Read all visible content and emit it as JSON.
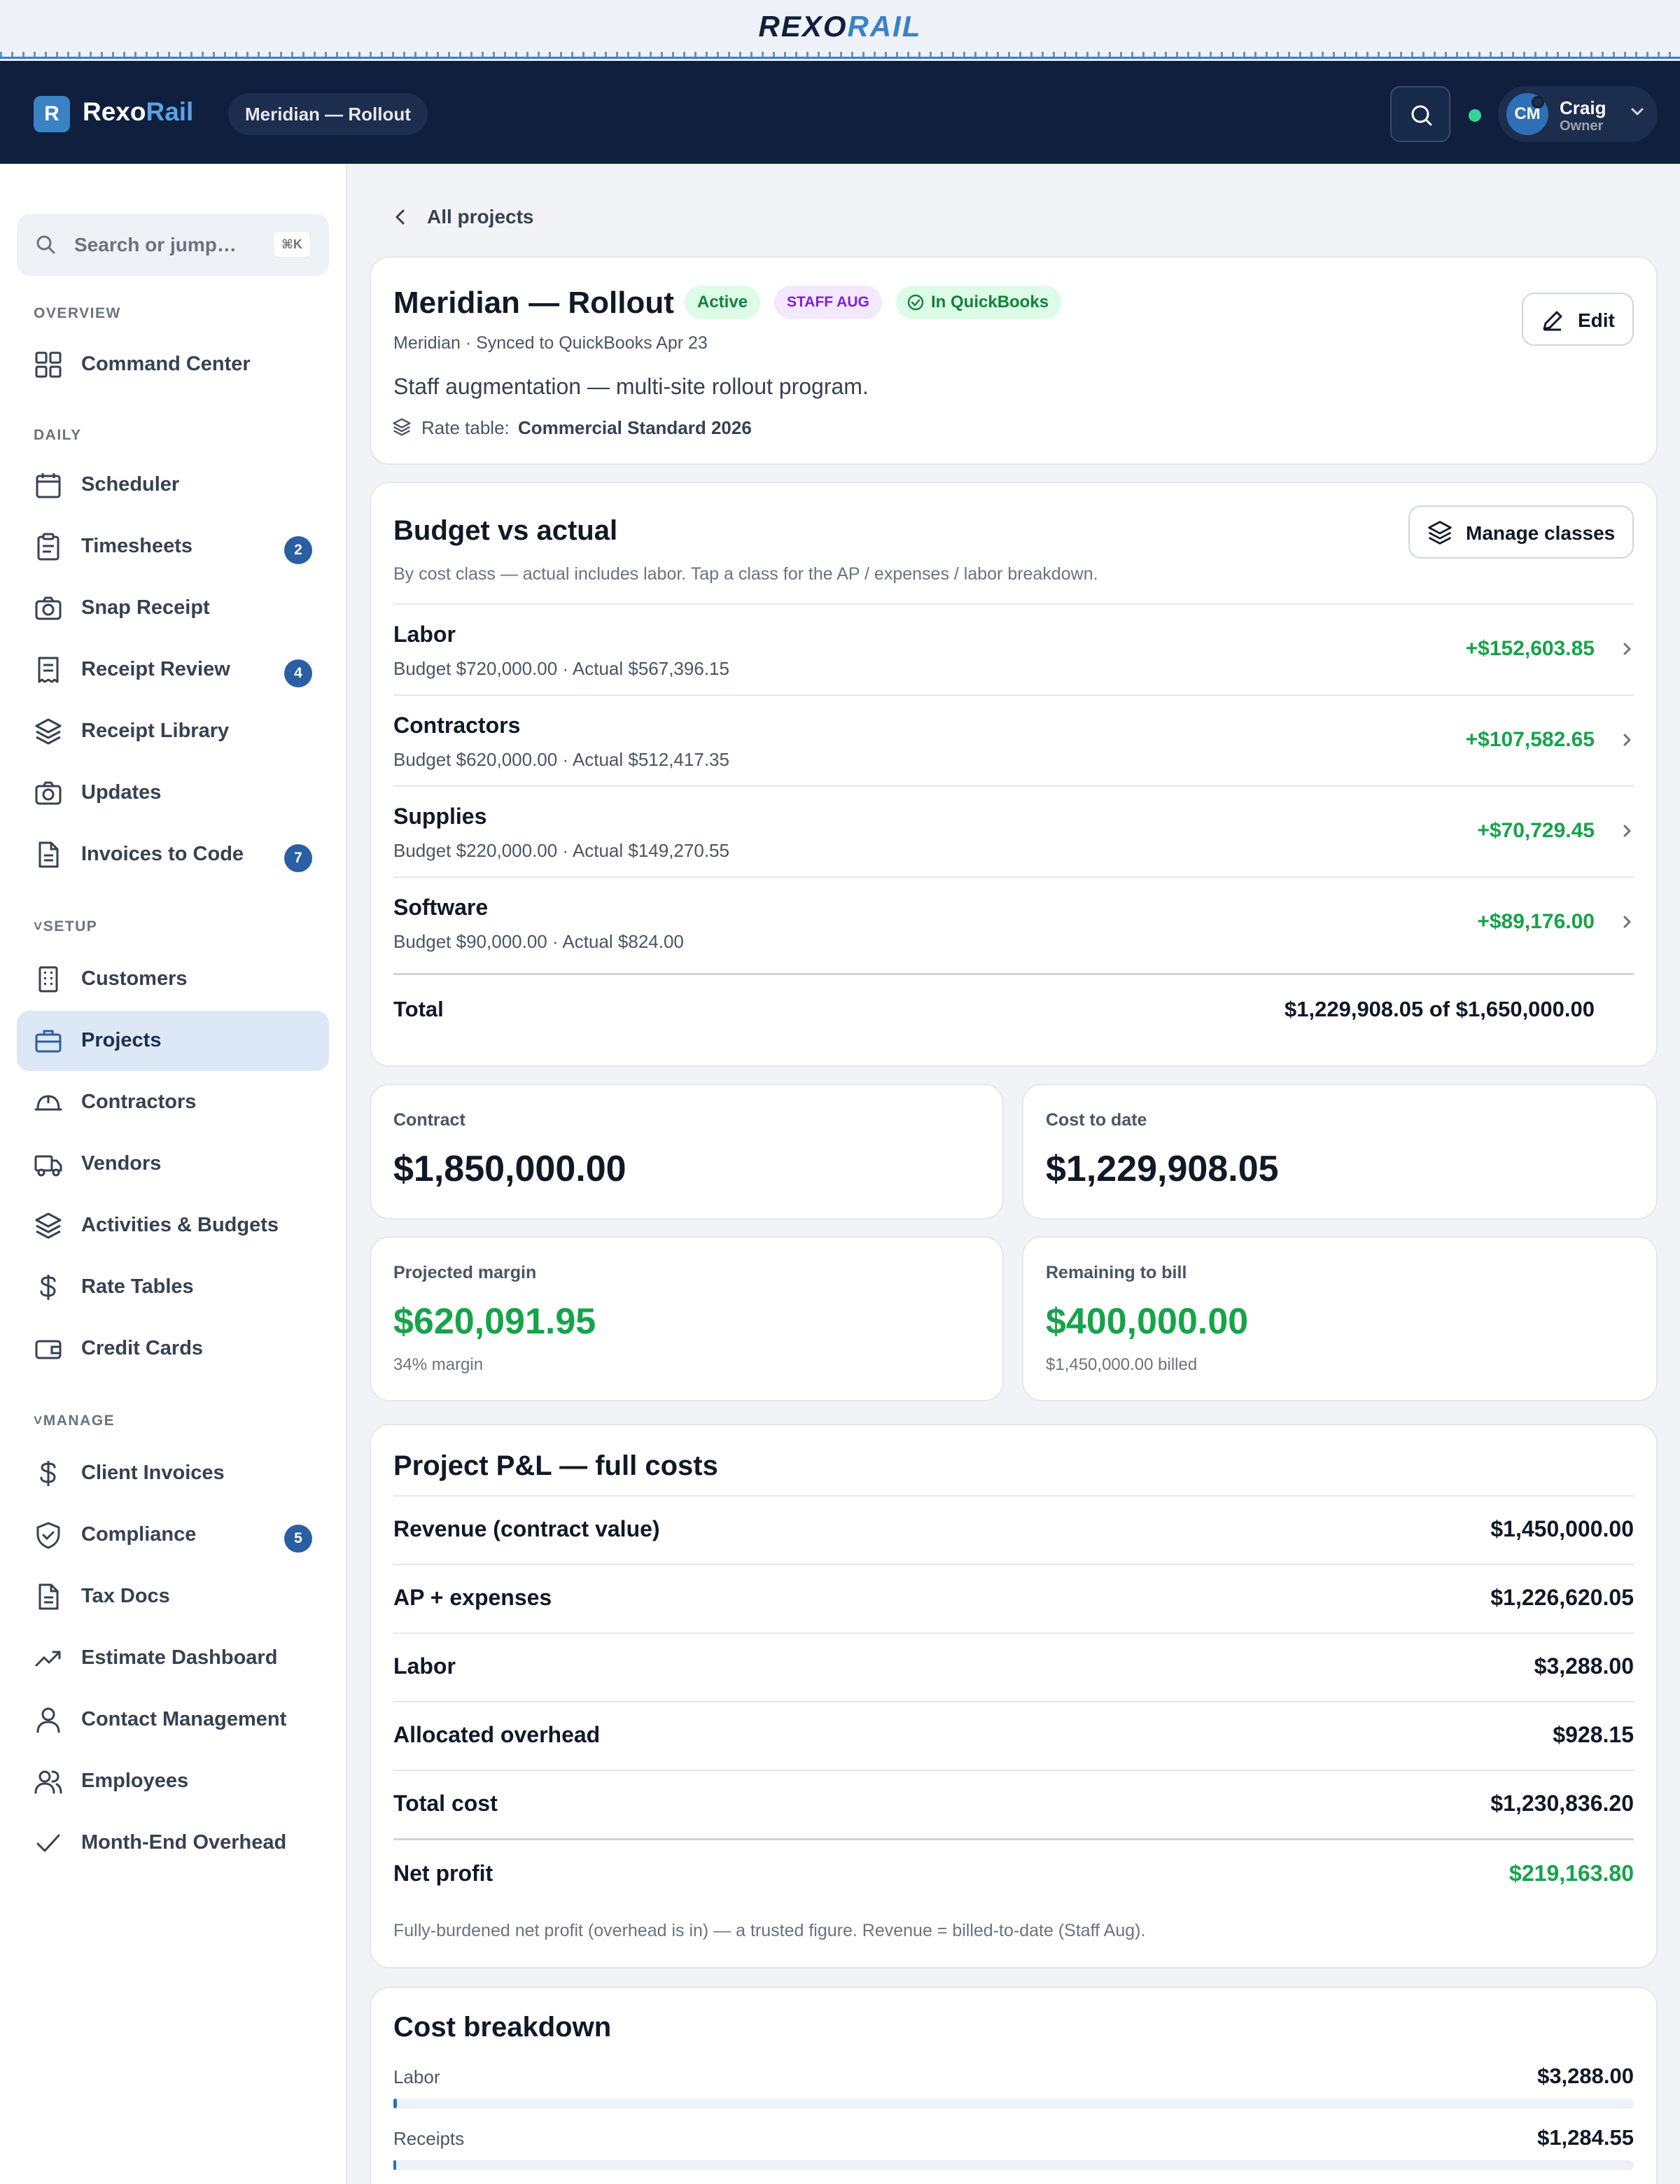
{
  "brand": {
    "wordmark_a": "REXO",
    "wordmark_b": "RAIL"
  },
  "header": {
    "logo_letter": "R",
    "app_name_a": "Rexo",
    "app_name_b": "Rail",
    "project_pill": "Meridian — Rollout",
    "user": {
      "initials": "CM",
      "name": "Craig",
      "role": "Owner"
    },
    "status_color": "#34d399"
  },
  "sidebar": {
    "search_placeholder": "Search or jump…",
    "search_shortcut": "⌘K",
    "sections": {
      "overview": "OVERVIEW",
      "daily": "DAILY",
      "setup": "SETUP",
      "manage": "MANAGE"
    },
    "items": [
      {
        "label": "Command Center",
        "icon": "grid-icon"
      },
      {
        "label": "Scheduler",
        "icon": "calendar-icon"
      },
      {
        "label": "Timesheets",
        "icon": "clipboard-icon",
        "badge": "2"
      },
      {
        "label": "Snap Receipt",
        "icon": "camera-icon"
      },
      {
        "label": "Receipt Review",
        "icon": "receipt-icon",
        "badge": "4"
      },
      {
        "label": "Receipt Library",
        "icon": "layers-icon"
      },
      {
        "label": "Updates",
        "icon": "camera-icon"
      },
      {
        "label": "Invoices to Code",
        "icon": "file-icon",
        "badge": "7"
      },
      {
        "label": "Customers",
        "icon": "building-icon"
      },
      {
        "label": "Projects",
        "icon": "briefcase-icon",
        "active": true
      },
      {
        "label": "Contractors",
        "icon": "hardhat-icon"
      },
      {
        "label": "Vendors",
        "icon": "truck-icon"
      },
      {
        "label": "Activities & Budgets",
        "icon": "layers-icon"
      },
      {
        "label": "Rate Tables",
        "icon": "dollar-icon"
      },
      {
        "label": "Credit Cards",
        "icon": "wallet-icon"
      },
      {
        "label": "Client Invoices",
        "icon": "dollar-icon"
      },
      {
        "label": "Compliance",
        "icon": "shield-icon",
        "badge": "5"
      },
      {
        "label": "Tax Docs",
        "icon": "file-icon"
      },
      {
        "label": "Estimate Dashboard",
        "icon": "trending-up-icon"
      },
      {
        "label": "Contact Management",
        "icon": "user-icon"
      },
      {
        "label": "Employees",
        "icon": "users-icon"
      },
      {
        "label": "Month-End Overhead",
        "icon": "check-icon"
      }
    ]
  },
  "main": {
    "back_label": "All projects",
    "project": {
      "title": "Meridian — Rollout",
      "tags": {
        "active": "Active",
        "type": "STAFF AUG",
        "qb": "In QuickBooks"
      },
      "meta": "Meridian · Synced to QuickBooks Apr 23",
      "description": "Staff augmentation — multi-site rollout program.",
      "rate_table_label": "Rate table:",
      "rate_table_value": "Commercial Standard 2026",
      "edit_label": "Edit"
    },
    "budget": {
      "title": "Budget vs actual",
      "manage_label": "Manage classes",
      "subtitle": "By cost class — actual includes labor. Tap a class for the AP / expenses / labor breakdown.",
      "rows": [
        {
          "name": "Labor",
          "detail": "Budget $720,000.00 · Actual $567,396.15",
          "variance": "+$152,603.85"
        },
        {
          "name": "Contractors",
          "detail": "Budget $620,000.00 · Actual $512,417.35",
          "variance": "+$107,582.65"
        },
        {
          "name": "Supplies",
          "detail": "Budget $220,000.00 · Actual $149,270.55",
          "variance": "+$70,729.45"
        },
        {
          "name": "Software",
          "detail": "Budget $90,000.00 · Actual $824.00",
          "variance": "+$89,176.00"
        }
      ],
      "total_label": "Total",
      "total_value": "$1,229,908.05 of $1,650,000.00"
    },
    "stats": {
      "contract": {
        "label": "Contract",
        "value": "$1,850,000.00"
      },
      "cost": {
        "label": "Cost to date",
        "value": "$1,229,908.05"
      },
      "margin": {
        "label": "Projected margin",
        "value": "$620,091.95",
        "sub": "34% margin"
      },
      "remaining": {
        "label": "Remaining to bill",
        "value": "$400,000.00",
        "sub": "$1,450,000.00 billed"
      }
    },
    "pl": {
      "title": "Project P&L — full costs",
      "rows": [
        {
          "label": "Revenue (contract value)",
          "value": "$1,450,000.00"
        },
        {
          "label": "AP + expenses",
          "value": "$1,226,620.05"
        },
        {
          "label": "Labor",
          "value": "$3,288.00"
        },
        {
          "label": "Allocated overhead",
          "value": "$928.15"
        },
        {
          "label": "Total cost",
          "value": "$1,230,836.20"
        }
      ],
      "net_label": "Net profit",
      "net_value": "$219,163.80",
      "note": "Fully-burdened net profit (overhead is in) — a trusted figure. Revenue = billed-to-date (Staff Aug)."
    },
    "breakdown": {
      "title": "Cost breakdown",
      "rows": [
        {
          "label": "Labor",
          "value": "$3,288.00",
          "share": 0.003
        },
        {
          "label": "Receipts",
          "value": "$1,284.55",
          "share": 0.001
        }
      ]
    }
  }
}
